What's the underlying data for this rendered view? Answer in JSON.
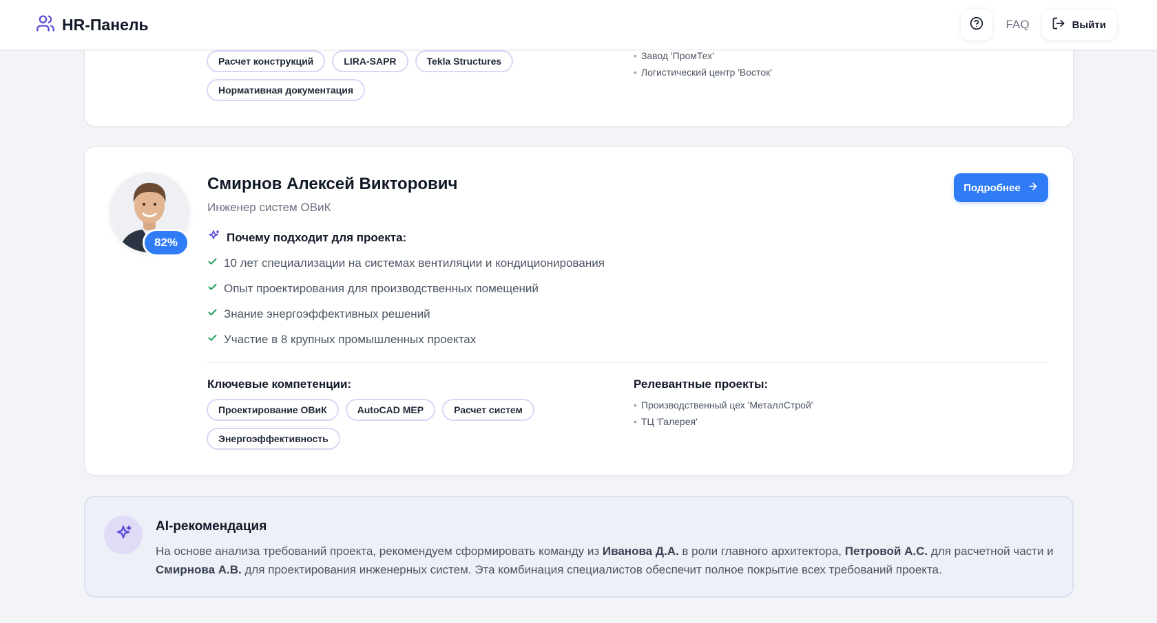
{
  "header": {
    "brand": "HR-Панель",
    "faq_label": "FAQ",
    "logout_label": "Выйти"
  },
  "prev_card": {
    "competencies": [
      "Расчет конструкций",
      "LIRA-SAPR",
      "Tekla Structures",
      "Нормативная документация"
    ],
    "projects": [
      "Завод 'ПромТех'",
      "Логистический центр 'Восток'"
    ]
  },
  "candidate": {
    "name": "Смирнов Алексей Викторович",
    "role": "Инженер систем ОВиК",
    "match": "82%",
    "details_label": "Подробнее",
    "why_title": "Почему подходит для проекта:",
    "reasons": [
      "10 лет специализации на системах вентиляции и кондиционирования",
      "Опыт проектирования для производственных помещений",
      "Знание энергоэффективных решений",
      "Участие в 8 крупных промышленных проектах"
    ],
    "competencies_title": "Ключевые компетенции:",
    "competencies": [
      "Проектирование ОВиК",
      "AutoCAD MEP",
      "Расчет систем",
      "Энергоэффективность"
    ],
    "projects_title": "Релевантные проекты:",
    "projects": [
      "Производственный цех 'МеталлСтрой'",
      "ТЦ 'Галерея'"
    ]
  },
  "ai": {
    "title": "AI-рекомендация",
    "t1": "На основе анализа требований проекта, рекомендуем сформировать команду из ",
    "b1": "Иванова Д.А.",
    "t2": " в роли главного архитектора, ",
    "b2": "Петровой А.С.",
    "t3": " для расчетной части и ",
    "b3": "Смирнова А.В.",
    "t4": " для проектирования инженерных систем. Эта комбинация специалистов обеспечит полное покрытие всех требований проекта."
  },
  "colors": {
    "accent": "#2f7cf6",
    "brand_icon": "#5b4fd6",
    "check": "#22a35a",
    "chip_border": "#d9d6f5",
    "ai_bg": "#eef0f8"
  },
  "icons": {
    "brand": "users-icon",
    "help": "help-circle-icon",
    "logout": "logout-icon",
    "sparkle": "sparkles-icon",
    "check": "check-icon",
    "arrow": "arrow-right-icon"
  }
}
